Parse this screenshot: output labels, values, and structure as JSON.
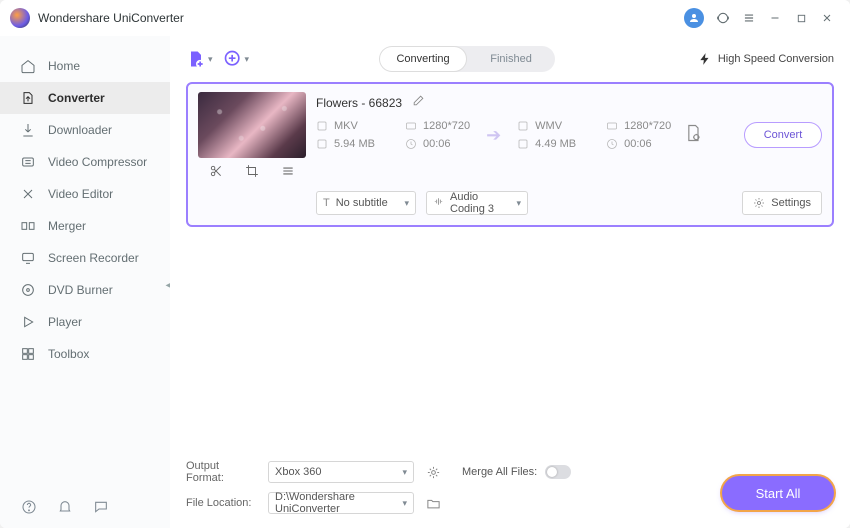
{
  "app": {
    "title": "Wondershare UniConverter"
  },
  "titlebar": {
    "avatar_initial": ""
  },
  "sidebar": {
    "items": [
      {
        "label": "Home",
        "icon": "home-icon"
      },
      {
        "label": "Converter",
        "icon": "converter-icon",
        "active": true
      },
      {
        "label": "Downloader",
        "icon": "downloader-icon"
      },
      {
        "label": "Video Compressor",
        "icon": "compressor-icon"
      },
      {
        "label": "Video Editor",
        "icon": "editor-icon"
      },
      {
        "label": "Merger",
        "icon": "merger-icon"
      },
      {
        "label": "Screen Recorder",
        "icon": "recorder-icon"
      },
      {
        "label": "DVD Burner",
        "icon": "burner-icon"
      },
      {
        "label": "Player",
        "icon": "player-icon"
      },
      {
        "label": "Toolbox",
        "icon": "toolbox-icon"
      }
    ]
  },
  "toolbar": {
    "tabs": {
      "converting": "Converting",
      "finished": "Finished",
      "active": "converting"
    },
    "highspeed_label": "High Speed Conversion"
  },
  "file": {
    "name": "Flowers - 66823",
    "source": {
      "format": "MKV",
      "resolution": "1280*720",
      "size": "5.94 MB",
      "duration": "00:06"
    },
    "target": {
      "format": "WMV",
      "resolution": "1280*720",
      "size": "4.49 MB",
      "duration": "00:06"
    },
    "subtitle_label": "No subtitle",
    "audio_label": "Audio Coding 3",
    "settings_label": "Settings",
    "convert_label": "Convert"
  },
  "footer": {
    "output_format_label": "Output Format:",
    "output_format_value": "Xbox 360",
    "file_location_label": "File Location:",
    "file_location_value": "D:\\Wondershare UniConverter",
    "merge_label": "Merge All Files:",
    "start_all_label": "Start All"
  }
}
